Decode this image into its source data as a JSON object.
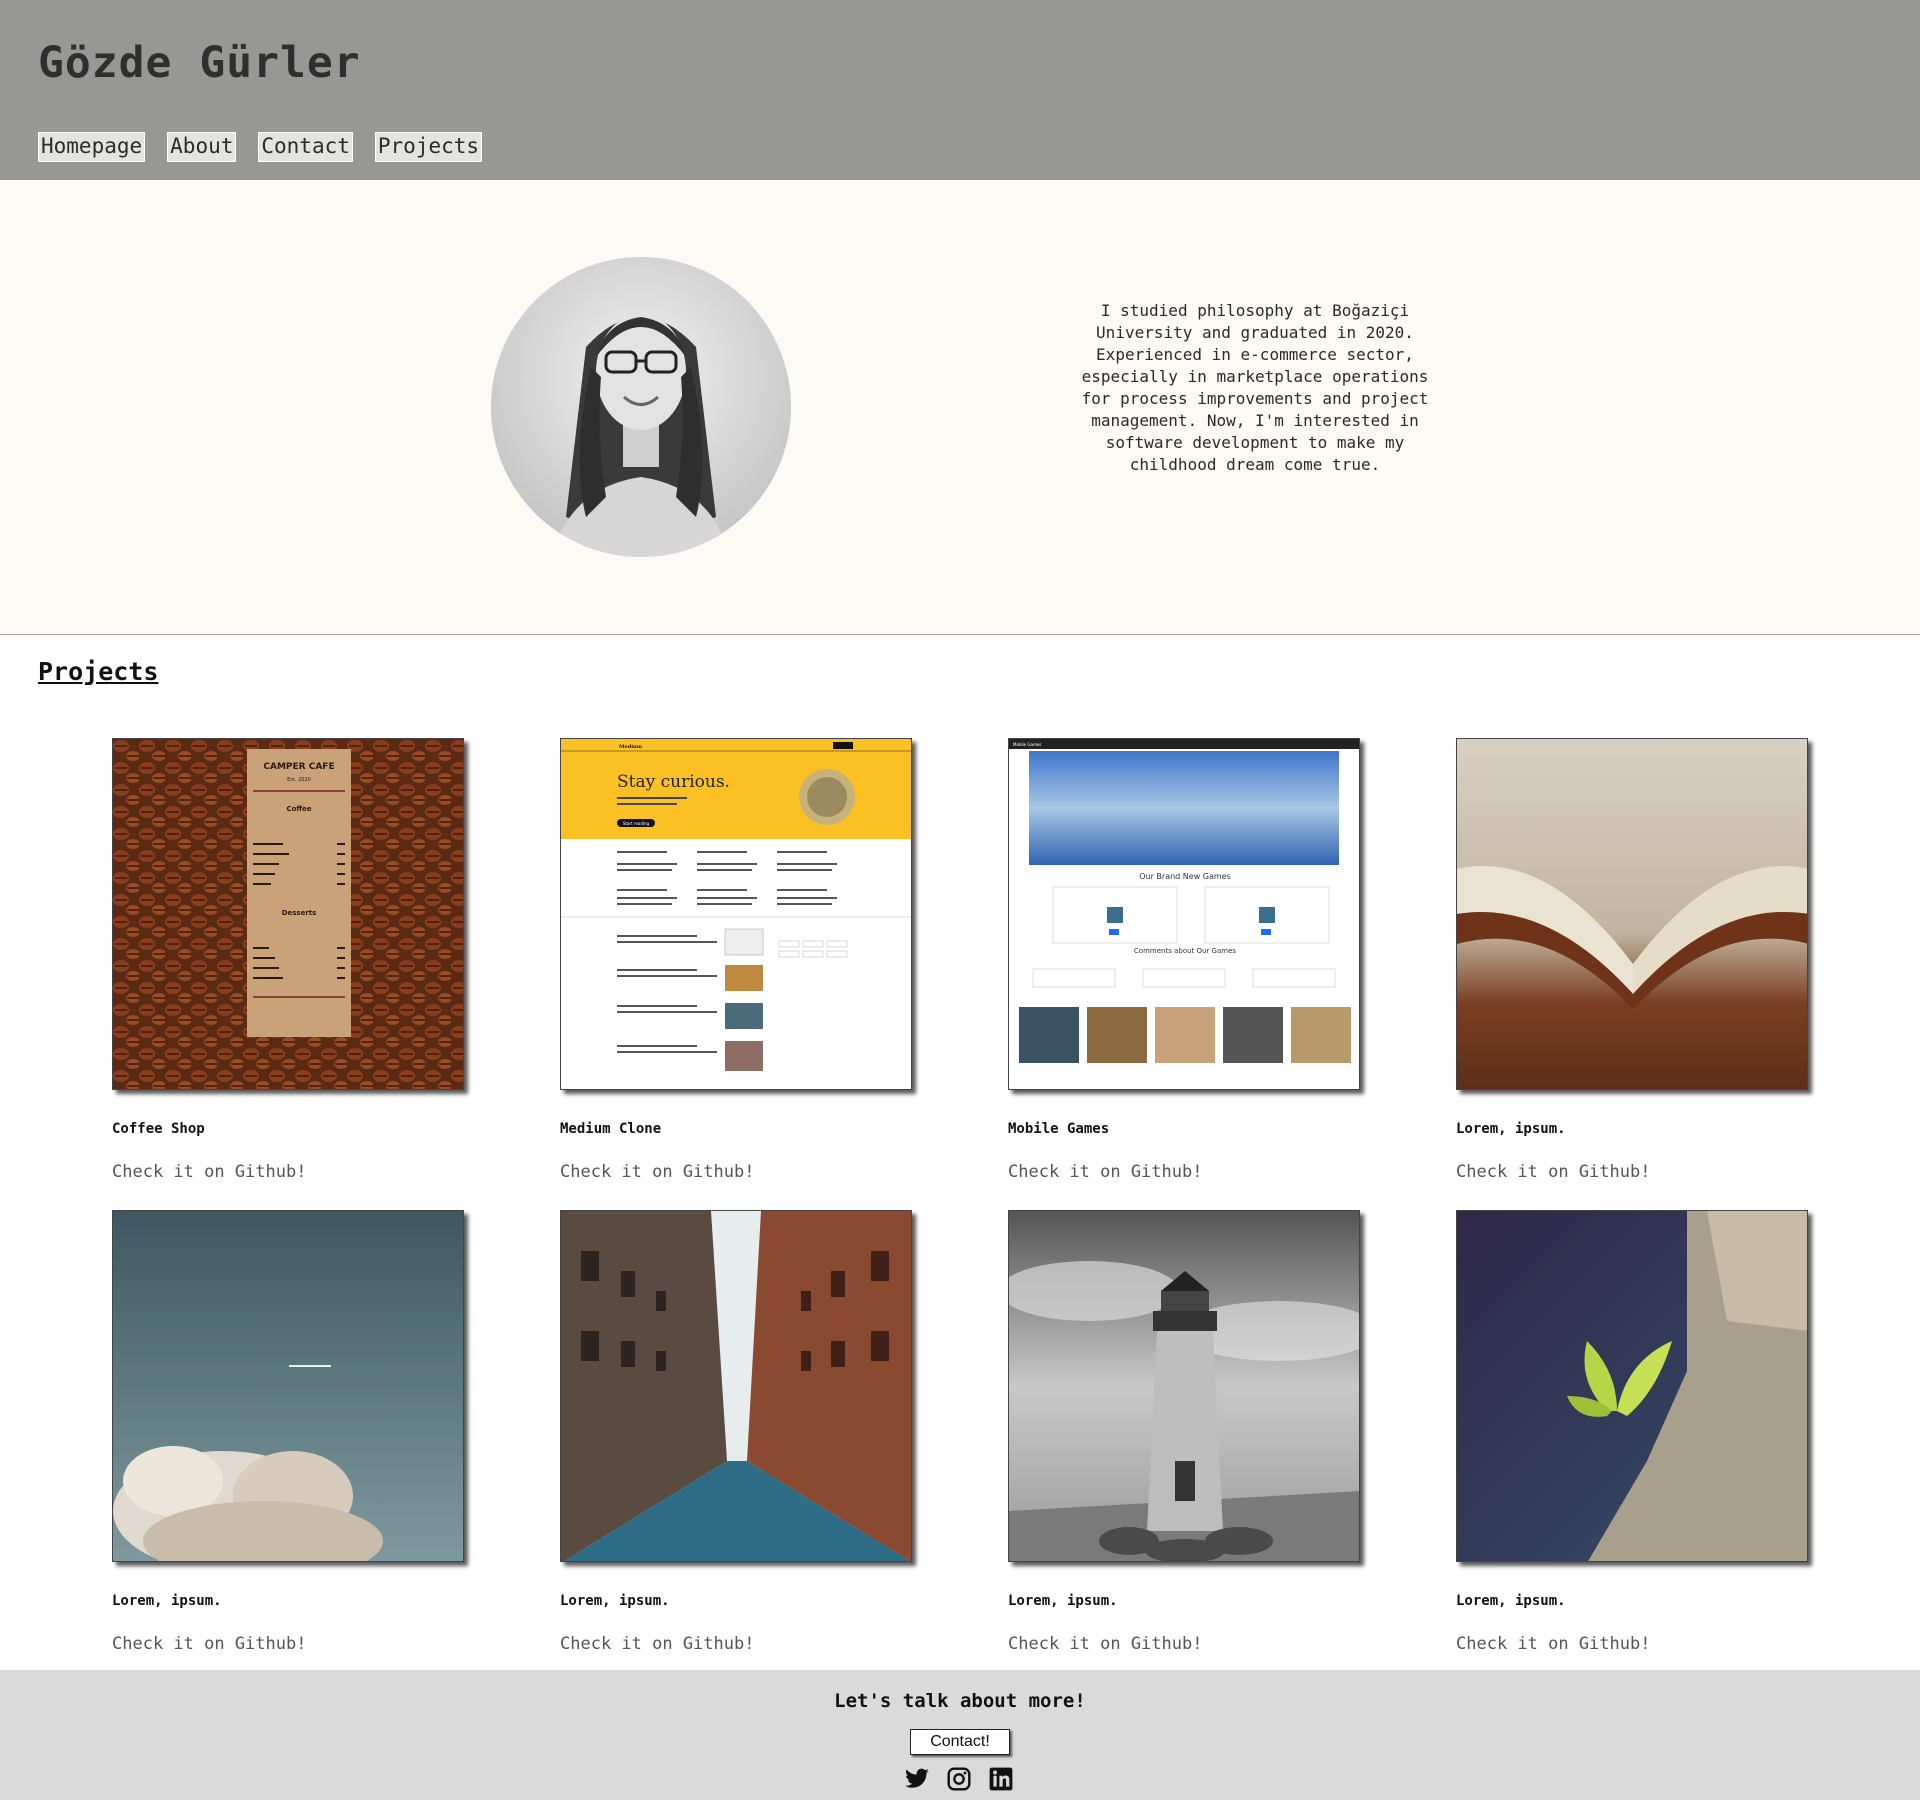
{
  "header": {
    "title": "Gözde Gürler",
    "nav": [
      "Homepage",
      "About",
      "Contact",
      "Projects"
    ],
    "bg_color": "#979893"
  },
  "about": {
    "avatar_icon": "profile-photo",
    "text": "I studied philosophy at Boğaziçi University and graduated in 2020. Experienced in e-commerce sector, especially in marketplace operations for process improvements and project management. Now, I'm interested in software development to make my childhood dream come true."
  },
  "projects": {
    "heading": "Projects",
    "items": [
      {
        "title": "Coffee Shop",
        "link": "Check it on Github!"
      },
      {
        "title": "Medium Clone",
        "link": "Check it on Github!"
      },
      {
        "title": "Mobile Games",
        "link": "Check it on Github!"
      },
      {
        "title": "Lorem, ipsum.",
        "link": "Check it on Github!"
      },
      {
        "title": "Lorem, ipsum.",
        "link": "Check it on Github!"
      },
      {
        "title": "Lorem, ipsum.",
        "link": "Check it on Github!"
      },
      {
        "title": "Lorem, ipsum.",
        "link": "Check it on Github!"
      },
      {
        "title": "Lorem, ipsum.",
        "link": "Check it on Github!"
      }
    ],
    "thumb_texts": {
      "cafe_title": "CAMPER CAFE",
      "cafe_est": "Est. 2020",
      "cafe_coffee": "Coffee",
      "cafe_desserts": "Desserts",
      "medium_brand": "Medium",
      "medium_headline": "Stay curious.",
      "medium_button": "Start reading",
      "games_brand": "Mobile Games",
      "games_heading": "Our Brand New Games",
      "games_comments": "Comments about Our Games"
    }
  },
  "footer": {
    "title": "Let's talk about more!",
    "button": "Contact!",
    "icons": [
      "twitter-icon",
      "instagram-icon",
      "linkedin-icon"
    ]
  }
}
